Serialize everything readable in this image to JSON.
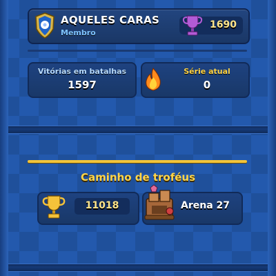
{
  "clan": {
    "name": "AQUELES CARAS",
    "role": "Membro",
    "trophies": "1690",
    "badge_icon": "clan-badge-shield-icon",
    "trophy_icon": "purple-trophy-icon"
  },
  "stats": {
    "wins_label": "Vitórias em batalhas",
    "wins_value": "1597",
    "streak_label": "Série atual",
    "streak_value": "0",
    "streak_icon": "flame-icon"
  },
  "trophy_road": {
    "title": "Caminho de troféus",
    "trophies": "11018",
    "trophy_icon": "gold-trophy-icon",
    "arena_name": "Arena 27",
    "arena_icon": "arena-icon"
  },
  "colors": {
    "background": "#2359ad",
    "gold": "#f2c43a",
    "label_blue": "#b5d9ff",
    "role_blue": "#7ec3ff",
    "trophy_text": "#ffe58a"
  }
}
